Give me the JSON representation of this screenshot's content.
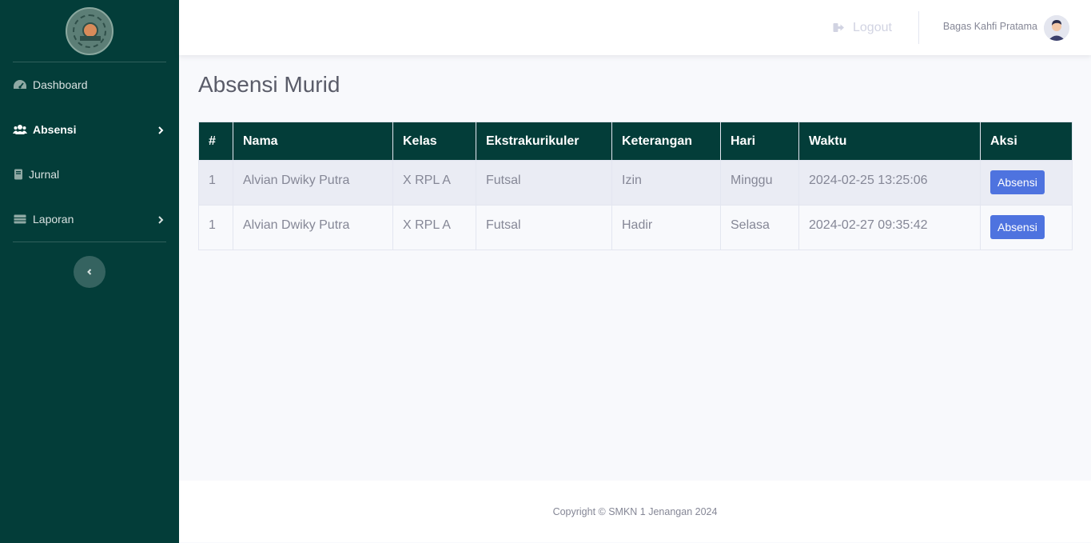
{
  "sidebar": {
    "school_logo_text": "SMK NEGERI 1 JENANGAN PONOROGO",
    "items": [
      {
        "label": "Dashboard",
        "icon": "tachometer-icon"
      },
      {
        "label": "Absensi",
        "icon": "users-icon"
      },
      {
        "label": "Jurnal",
        "icon": "book-icon"
      },
      {
        "label": "Laporan",
        "icon": "table-icon"
      }
    ],
    "active": "Absensi",
    "colors": {
      "background": "#033d39"
    }
  },
  "topbar": {
    "logout_label": "Logout",
    "user_name": "Bagas Kahfi Pratama"
  },
  "main": {
    "title": "Absensi Murid",
    "table": {
      "headers": [
        "#",
        "Nama",
        "Kelas",
        "Ekstrakurikuler",
        "Keterangan",
        "Hari",
        "Waktu",
        "Aksi"
      ],
      "rows": [
        {
          "no": "1",
          "nama": "Alvian Dwiky Putra",
          "kelas": "X RPL A",
          "ekskul": "Futsal",
          "keterangan": "Izin",
          "hari": "Minggu",
          "waktu": "2024-02-25 13:25:06",
          "aksi": "Absensi"
        },
        {
          "no": "1",
          "nama": "Alvian Dwiky Putra",
          "kelas": "X RPL A",
          "ekskul": "Futsal",
          "keterangan": "Hadir",
          "hari": "Selasa",
          "waktu": "2024-02-27 09:35:42",
          "aksi": "Absensi"
        }
      ]
    }
  },
  "footer": {
    "copyright": "Copyright © SMKN 1 Jenangan 2024"
  },
  "colors": {
    "accent": "#4e73df",
    "header_bg": "#033d39"
  }
}
